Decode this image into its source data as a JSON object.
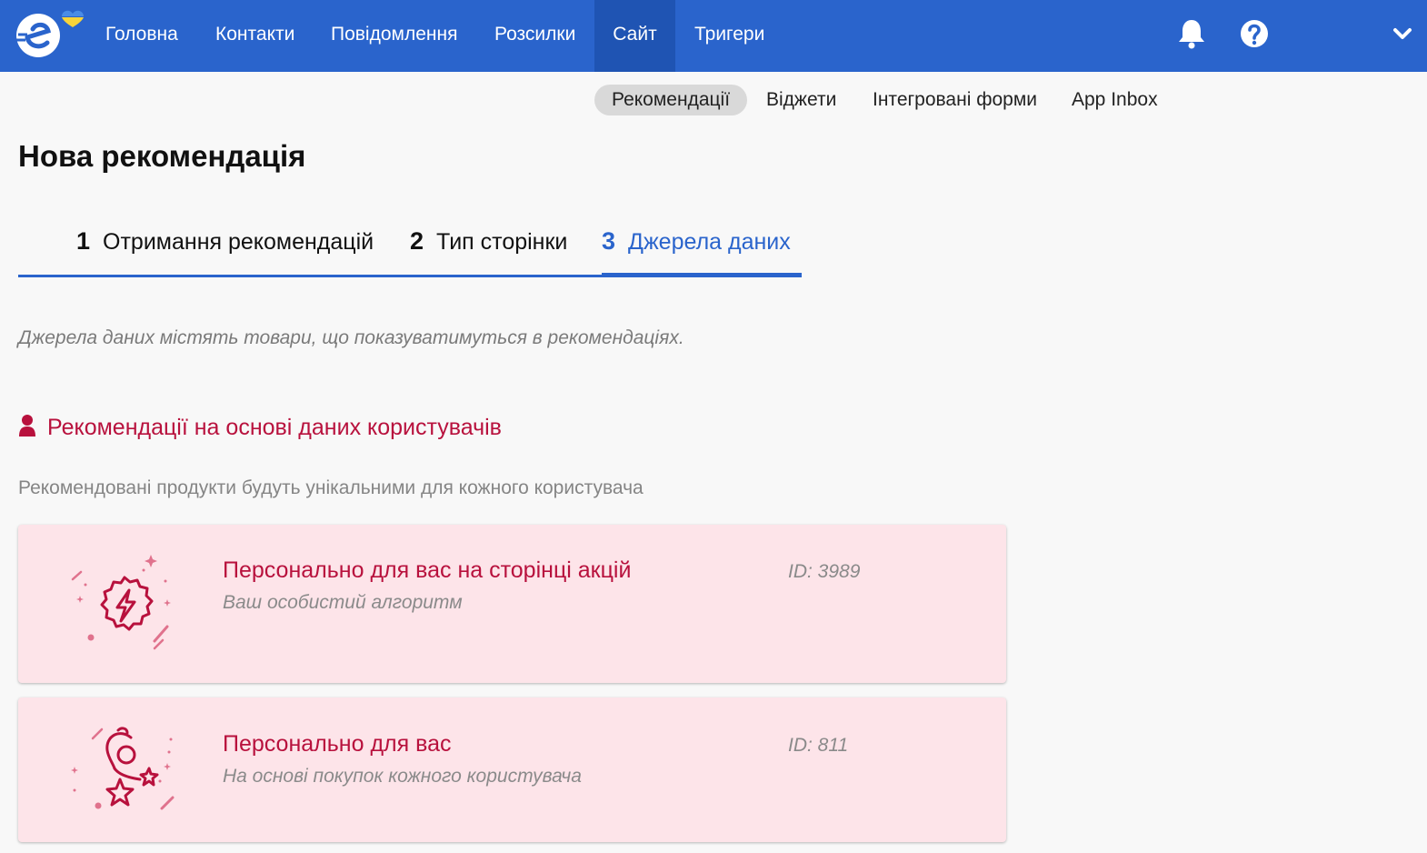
{
  "app": {
    "nav": {
      "items": [
        {
          "label": "Головна"
        },
        {
          "label": "Контакти"
        },
        {
          "label": "Повідомлення"
        },
        {
          "label": "Розсилки"
        },
        {
          "label": "Сайт"
        },
        {
          "label": "Тригери"
        }
      ],
      "active_label": "Сайт",
      "icons": {
        "notifications": "bell-icon",
        "help": "help-circle-icon",
        "menu": "chevron-down-icon"
      }
    },
    "subnav": {
      "items": [
        {
          "label": "Рекомендації"
        },
        {
          "label": "Віджети"
        },
        {
          "label": "Інтегровані форми"
        },
        {
          "label": "App Inbox"
        }
      ],
      "active_label": "Рекомендації"
    }
  },
  "page": {
    "title": "Нова рекомендація",
    "steps": [
      {
        "number": "1",
        "label": "Отримання рекомендацій"
      },
      {
        "number": "2",
        "label": "Тип сторінки"
      },
      {
        "number": "3",
        "label": "Джерела даних"
      }
    ],
    "active_step": "3",
    "hint": "Джерела даних містять товари, що показуватимуться в рекомендаціях.",
    "section": {
      "title": "Рекомендації на основі даних користувачів",
      "description": "Рекомендовані продукти будуть унікальними для кожного користувача",
      "icon": "user-icon"
    },
    "cards": [
      {
        "title": "Персонально для вас на сторінці акцій",
        "subtitle": "Ваш особистий алгоритм",
        "id": "ID: 3989",
        "icon": "lightning-badge-icon"
      },
      {
        "title": "Персонально для вас",
        "subtitle": "На основі покупок кожного користувача",
        "id": "ID: 811",
        "icon": "person-stars-icon"
      }
    ]
  },
  "colors": {
    "nav_bg": "#2a64cc",
    "nav_active_bg": "#1f54b3",
    "accent": "#2a64cc",
    "crimson": "#b8113d",
    "card_bg": "#fde4e9",
    "page_bg": "#f8f8f8"
  }
}
